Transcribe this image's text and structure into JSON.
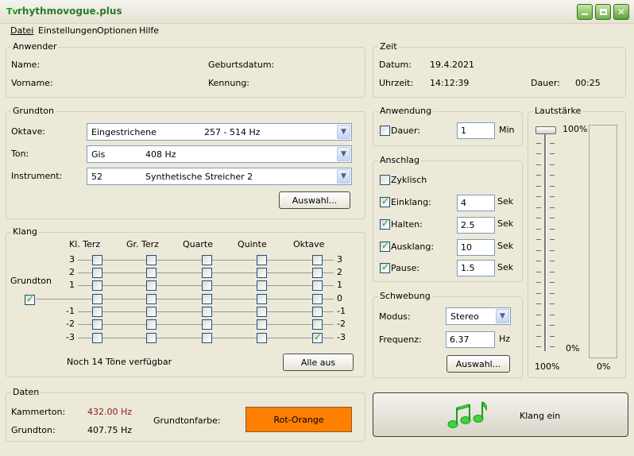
{
  "window": {
    "title": "rhythmovogue.plus",
    "icon_text": "Tv"
  },
  "menu": [
    "Datei",
    "Einstellungen",
    "Optionen",
    "Hilfe"
  ],
  "anwender": {
    "group": "Anwender",
    "name_label": "Name:",
    "birth_label": "Geburtsdatum:",
    "vorname_label": "Vorname:",
    "kennung_label": "Kennung:"
  },
  "zeit": {
    "group": "Zeit",
    "datum_label": "Datum:",
    "datum_value": "19.4.2021",
    "uhrzeit_label": "Uhrzeit:",
    "uhrzeit_value": "14:12:39",
    "dauer_label": "Dauer:",
    "dauer_value": "00:25"
  },
  "grundton": {
    "group": "Grundton",
    "oktave_label": "Oktave:",
    "oktave_name": "Eingestrichene",
    "oktave_range": "257 - 514 Hz",
    "ton_label": "Ton:",
    "ton_name": "Gis",
    "ton_freq": "408 Hz",
    "instrument_label": "Instrument:",
    "instrument_num": "52",
    "instrument_name": "Synthetische Streicher 2",
    "auswahl_button": "Auswahl..."
  },
  "anwendung": {
    "group": "Anwendung",
    "dauer_label": "Dauer:",
    "dauer_value": "1",
    "unit": "Min"
  },
  "anschlag": {
    "group": "Anschlag",
    "zyklisch_label": "Zyklisch",
    "rows": [
      {
        "label": "Einklang:",
        "value": "4",
        "unit": "Sek"
      },
      {
        "label": "Halten:",
        "value": "2.5",
        "unit": "Sek"
      },
      {
        "label": "Ausklang:",
        "value": "10",
        "unit": "Sek"
      },
      {
        "label": "Pause:",
        "value": "1.5",
        "unit": "Sek"
      }
    ]
  },
  "schwebung": {
    "group": "Schwebung",
    "modus_label": "Modus:",
    "modus_value": "Stereo",
    "frequenz_label": "Frequenz:",
    "frequenz_value": "6.37",
    "frequenz_unit": "Hz",
    "auswahl_button": "Auswahl..."
  },
  "lautstaerke": {
    "group": "Lautstärke",
    "top_label": "100%",
    "bottom_label": "0%",
    "value_label": "100%",
    "meter_value": "0%",
    "level": 1.0
  },
  "klang": {
    "group": "Klang",
    "columns": [
      "Kl. Terz",
      "Gr. Terz",
      "Quarte",
      "Quinte",
      "Oktave"
    ],
    "rows": [
      "3",
      "2",
      "1",
      "0",
      "-1",
      "-2",
      "-3"
    ],
    "left_rows": [
      "3",
      "2",
      "1",
      "",
      "-1",
      "-2",
      "-3"
    ],
    "grundton_label": "Grundton",
    "remaining_text": "Noch 14 Töne verfügbar",
    "alle_aus_button": "Alle aus"
  },
  "daten": {
    "group": "Daten",
    "kammerton_label": "Kammerton:",
    "kammerton_value": "432.00 Hz",
    "grundton_label": "Grundton:",
    "grundton_value": "407.75 Hz",
    "farbe_label": "Grundtonfarbe:",
    "farbe_value": "Rot-Orange",
    "farbe_color": "#ff7f00",
    "kammerton_color": "#8b1a1a"
  },
  "klang_ein": {
    "label": "Klang ein",
    "icon": "music-notes-icon"
  }
}
